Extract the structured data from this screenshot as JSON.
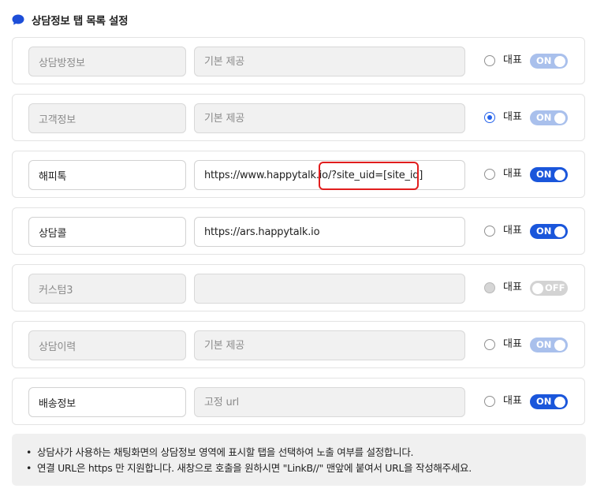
{
  "section_title": "상담정보 탭 목록 설정",
  "rep_label": "대표",
  "rows": [
    {
      "name": "상담방정보",
      "url_value": "",
      "url_placeholder": "기본 제공",
      "name_disabled": true,
      "url_disabled": true,
      "rep_checked": false,
      "rep_disabled": false,
      "toggle": "ON",
      "toggle_style": "on-dim"
    },
    {
      "name": "고객정보",
      "url_value": "",
      "url_placeholder": "기본 제공",
      "name_disabled": true,
      "url_disabled": true,
      "rep_checked": true,
      "rep_disabled": false,
      "toggle": "ON",
      "toggle_style": "on-dim"
    },
    {
      "name": "해피톡",
      "url_value": "https://www.happytalk.io/?site_uid=[site_id]",
      "url_placeholder": "",
      "name_disabled": false,
      "url_disabled": false,
      "rep_checked": false,
      "rep_disabled": false,
      "toggle": "ON",
      "toggle_style": "on"
    },
    {
      "name": "상담콜",
      "url_value": "https://ars.happytalk.io",
      "url_placeholder": "",
      "name_disabled": false,
      "url_disabled": false,
      "rep_checked": false,
      "rep_disabled": false,
      "toggle": "ON",
      "toggle_style": "on"
    },
    {
      "name": "커스텀3",
      "url_value": "",
      "url_placeholder": "",
      "name_disabled": true,
      "url_disabled": true,
      "rep_checked": false,
      "rep_disabled": true,
      "toggle": "OFF",
      "toggle_style": "off"
    },
    {
      "name": "상담이력",
      "url_value": "",
      "url_placeholder": "기본 제공",
      "name_disabled": true,
      "url_disabled": true,
      "rep_checked": false,
      "rep_disabled": false,
      "toggle": "ON",
      "toggle_style": "on-dim"
    },
    {
      "name": "배송정보",
      "url_value": "",
      "url_placeholder": "고정 url",
      "name_disabled": false,
      "url_disabled": true,
      "rep_checked": false,
      "rep_disabled": false,
      "toggle": "ON",
      "toggle_style": "on"
    }
  ],
  "notice": {
    "bullet": "•",
    "lines": [
      "상담사가 사용하는 채팅화면의 상담정보 영역에 표시할 탭을 선택하여 노출 여부를 설정합니다.",
      "연결 URL은 https 만 지원합니다. 새창으로 호출을 원하시면 \"LinkB//\" 맨앞에 붙여서 URL을 작성해주세요."
    ]
  },
  "colors": {
    "accent": "#1a56db",
    "toggle_dim": "#a9c0ec",
    "toggle_off": "#d3d3d3",
    "highlight": "#e11d1d",
    "chat_icon": "#1d4ed8"
  },
  "icons": {
    "title_icon": "speech-bubble-icon"
  }
}
